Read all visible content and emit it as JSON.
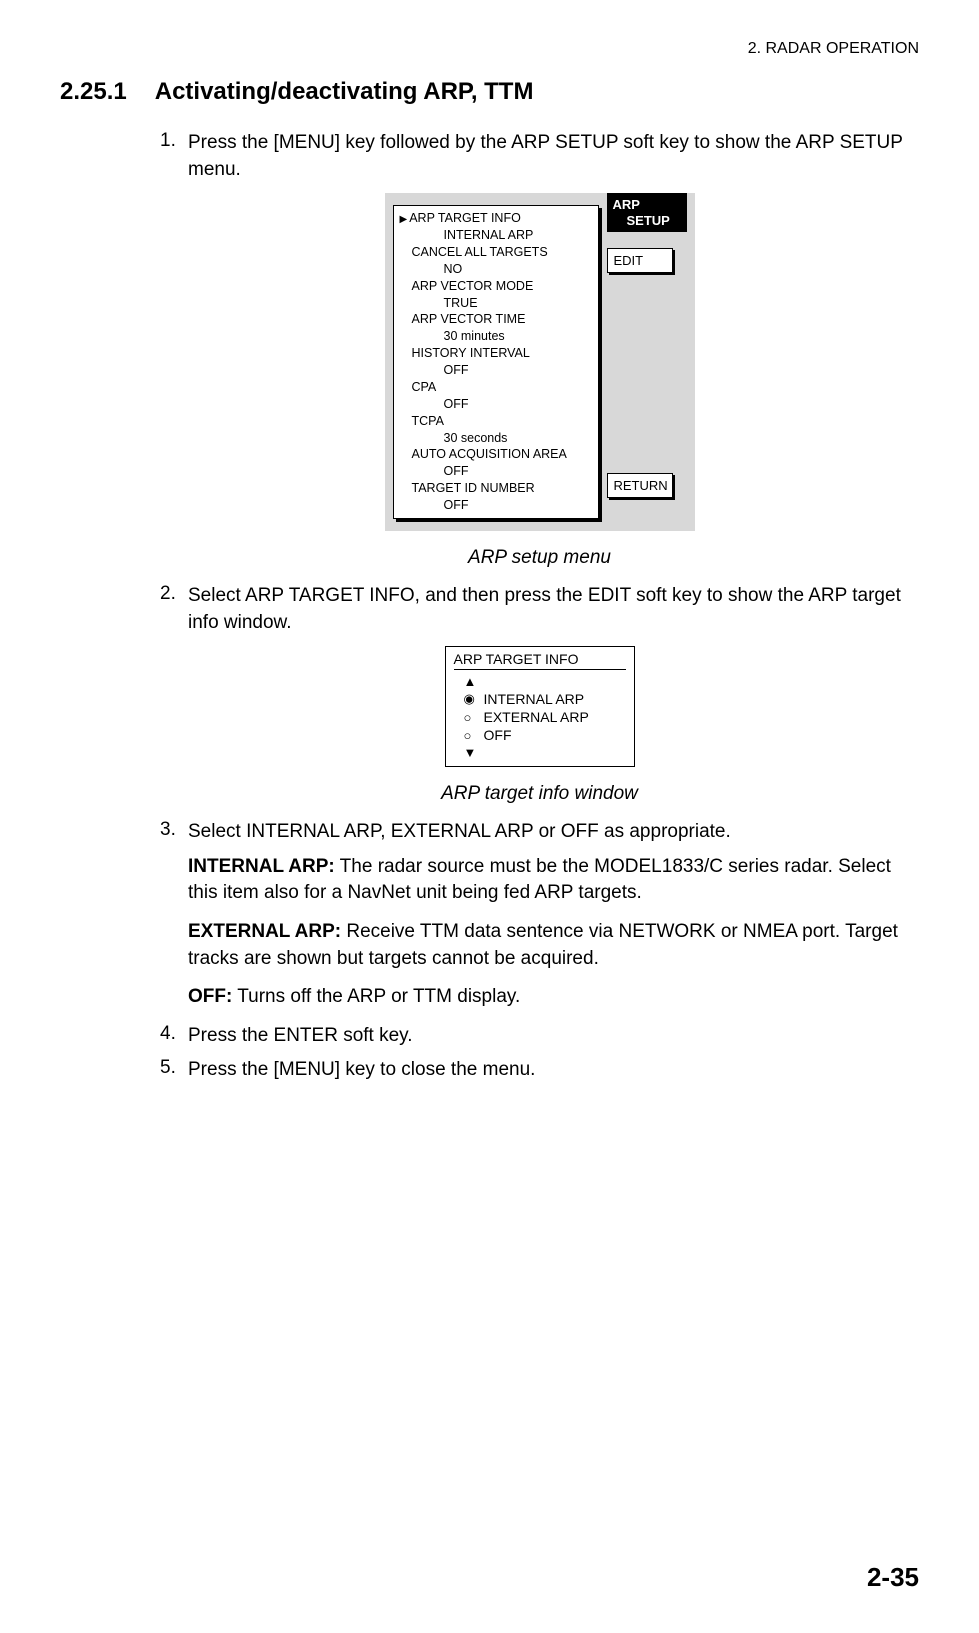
{
  "header": {
    "chapter_label": "2. RADAR OPERATION"
  },
  "section": {
    "number": "2.25.1",
    "title": "Activating/deactivating ARP, TTM"
  },
  "steps": {
    "s1": {
      "num": "1.",
      "text": "Press the [MENU] key followed by the ARP SETUP soft key to show the ARP SETUP menu."
    },
    "s2": {
      "num": "2.",
      "text": "Select ARP TARGET INFO, and then press the EDIT soft key to show the ARP target info window."
    },
    "s3": {
      "num": "3.",
      "text": "Select INTERNAL ARP, EXTERNAL ARP or OFF as appropriate."
    },
    "s4": {
      "num": "4.",
      "text": "Press the ENTER soft key."
    },
    "s5": {
      "num": "5.",
      "text": "Press the [MENU] key to close the menu."
    }
  },
  "arp_menu": {
    "items": [
      {
        "label": "ARP TARGET INFO",
        "value": "INTERNAL ARP"
      },
      {
        "label": "CANCEL ALL TARGETS",
        "value": "NO"
      },
      {
        "label": "ARP VECTOR MODE",
        "value": "TRUE"
      },
      {
        "label": "ARP VECTOR TIME",
        "value": "30 minutes"
      },
      {
        "label": "HISTORY INTERVAL",
        "value": "OFF"
      },
      {
        "label": "CPA",
        "value": "OFF"
      },
      {
        "label": "TCPA",
        "value": "30 seconds"
      },
      {
        "label": "AUTO ACQUISITION AREA",
        "value": "OFF"
      },
      {
        "label": "TARGET ID NUMBER",
        "value": "OFF"
      }
    ],
    "softkeys": {
      "title1": "ARP",
      "title2": "SETUP",
      "edit": "EDIT",
      "return": "RETURN"
    },
    "caption": "ARP setup menu"
  },
  "target_info": {
    "title": "ARP TARGET INFO",
    "options": [
      {
        "label": "INTERNAL ARP",
        "selected": true
      },
      {
        "label": "EXTERNAL ARP",
        "selected": false
      },
      {
        "label": "OFF",
        "selected": false
      }
    ],
    "caption": "ARP target info window"
  },
  "descriptions": {
    "internal": {
      "head": "INTERNAL ARP:",
      "body": " The radar source must be the MODEL1833/C series radar. Select this item also for a NavNet unit being fed ARP targets."
    },
    "external": {
      "head": "EXTERNAL ARP:",
      "body": " Receive TTM data sentence via NETWORK or NMEA port. Target tracks are shown but targets cannot be acquired."
    },
    "off": {
      "head": "OFF:",
      "body": " Turns off the ARP or TTM display."
    }
  },
  "page_number": "2-35"
}
